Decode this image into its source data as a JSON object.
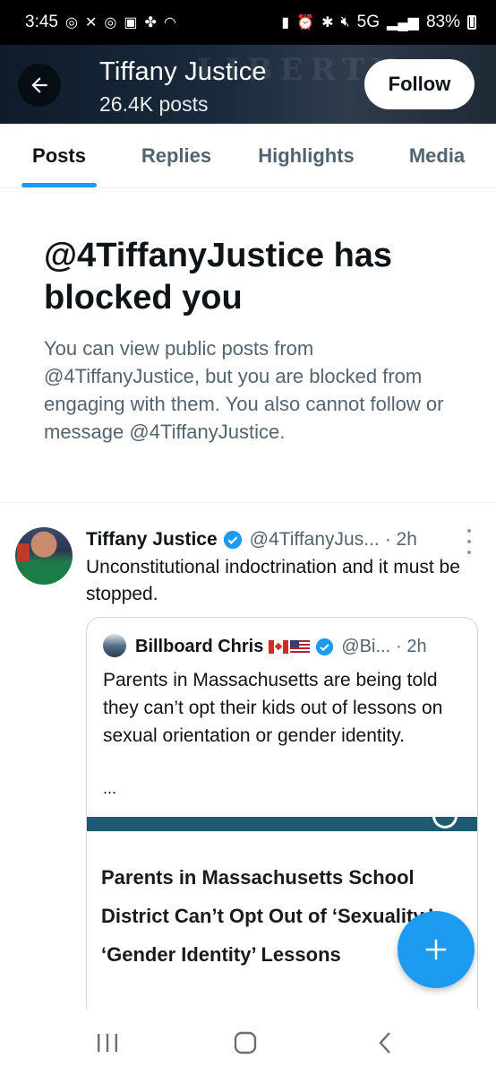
{
  "status_bar": {
    "time": "3:45",
    "network": "5G",
    "battery": "83%"
  },
  "header": {
    "title": "Tiffany Justice",
    "subtitle": "26.4K posts",
    "follow_label": "Follow",
    "banner_text": "LIBERTY"
  },
  "tabs": [
    {
      "label": "Posts",
      "active": true
    },
    {
      "label": "Replies",
      "active": false
    },
    {
      "label": "Highlights",
      "active": false
    },
    {
      "label": "Media",
      "active": false
    }
  ],
  "blocked": {
    "title": "@4TiffanyJustice has blocked you",
    "description": "You can view public posts from @4TiffanyJustice, but you are blocked from engaging with them. You also cannot follow or message @4TiffanyJustice."
  },
  "tweet": {
    "name": "Tiffany Justice",
    "handle": "@4TiffanyJus...",
    "time": "· 2h",
    "text": "Unconstitutional indoctrination and it must be stopped.",
    "quote": {
      "name": "Billboard Chris",
      "handle": "@Bi...",
      "time": "· 2h",
      "text": "Parents in Massachusetts are being told they can’t opt their kids out of lessons on sexual orientation or gender identity.",
      "ellipsis": "...",
      "article_title": "Parents in Massachusetts School District Can’t Opt Out of ‘Sexuality,’ ‘Gender Identity’ Lessons"
    }
  },
  "colors": {
    "accent": "#1d9bf0",
    "text_primary": "#0f1419",
    "text_secondary": "#536471"
  },
  "icons": [
    "back-arrow-icon",
    "verified-badge-icon",
    "more-options-icon",
    "compose-plus-icon",
    "recent-apps-icon",
    "home-icon",
    "back-icon"
  ]
}
